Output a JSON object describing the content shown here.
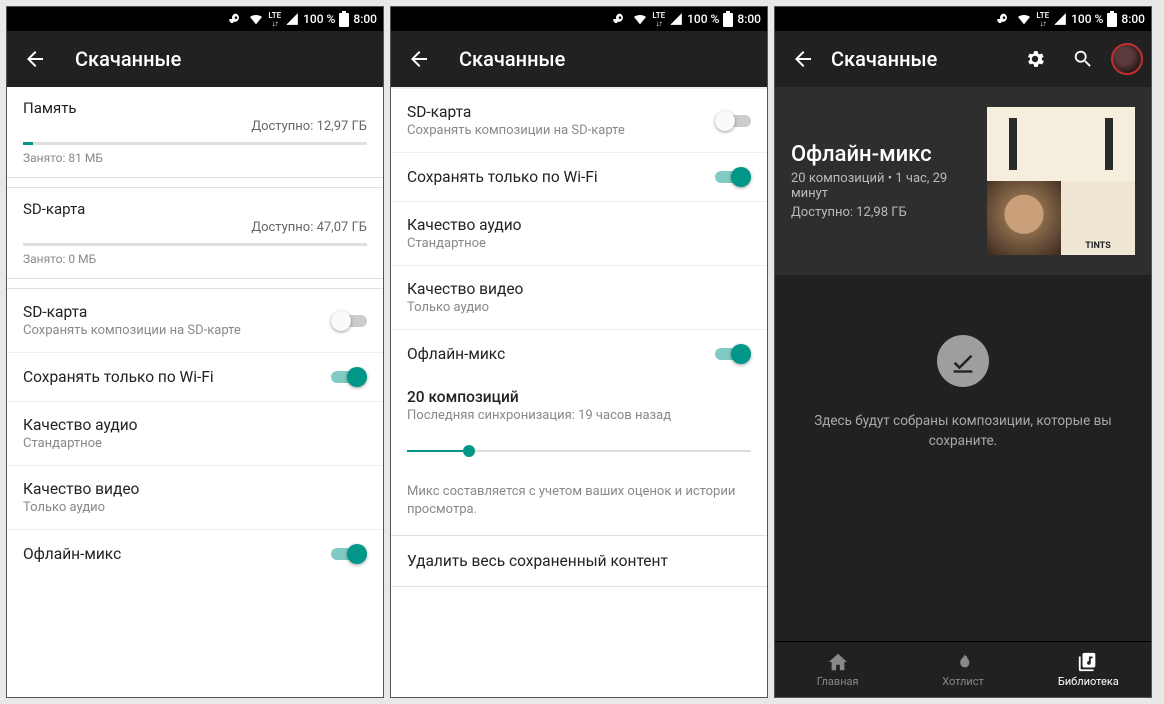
{
  "statusbar": {
    "battery": "100 %",
    "time": "8:00",
    "lte": "LTE"
  },
  "appbar_title": "Скачанные",
  "s1": {
    "mem": {
      "name": "Память",
      "avail": "Доступно: 12,97 ГБ",
      "used": "Занято: 81 МБ",
      "fill_pct": 3
    },
    "sd": {
      "name": "SD-карта",
      "avail": "Доступно: 47,07 ГБ",
      "used": "Занято: 0 МБ",
      "fill_pct": 0
    },
    "sd_toggle": {
      "title": "SD-карта",
      "sub": "Сохранять композиции на SD-карте",
      "on": false
    },
    "wifi": {
      "title": "Сохранять только по Wi-Fi",
      "on": true
    },
    "audio": {
      "title": "Качество аудио",
      "sub": "Стандартное"
    },
    "video": {
      "title": "Качество видео",
      "sub": "Только аудио"
    },
    "offline": {
      "title": "Офлайн-микс",
      "on": true
    }
  },
  "s2": {
    "sd_toggle": {
      "title": "SD-карта",
      "sub": "Сохранять композиции на SD-карте",
      "on": false
    },
    "wifi": {
      "title": "Сохранять только по Wi-Fi",
      "on": true
    },
    "audio": {
      "title": "Качество аудио",
      "sub": "Стандартное"
    },
    "video": {
      "title": "Качество видео",
      "sub": "Только аудио"
    },
    "offline": {
      "title": "Офлайн-микс",
      "on": true
    },
    "slider": {
      "label": "20 композиций",
      "sub": "Последняя синхронизация: 19 часов назад",
      "pct": 18
    },
    "note": "Микс составляется с учетом ваших оценок и истории просмотра.",
    "delete": "Удалить весь сохраненный контент"
  },
  "s3": {
    "mix_title": "Офлайн-микс",
    "mix_line1": "20 композиций • 1 час, 29 минут",
    "mix_line2": "Доступно: 12,98 ГБ",
    "empty_msg": "Здесь будут собраны композиции, которые вы сохраните.",
    "nav": {
      "home": "Главная",
      "hot": "Хотлист",
      "lib": "Библиотека"
    }
  }
}
